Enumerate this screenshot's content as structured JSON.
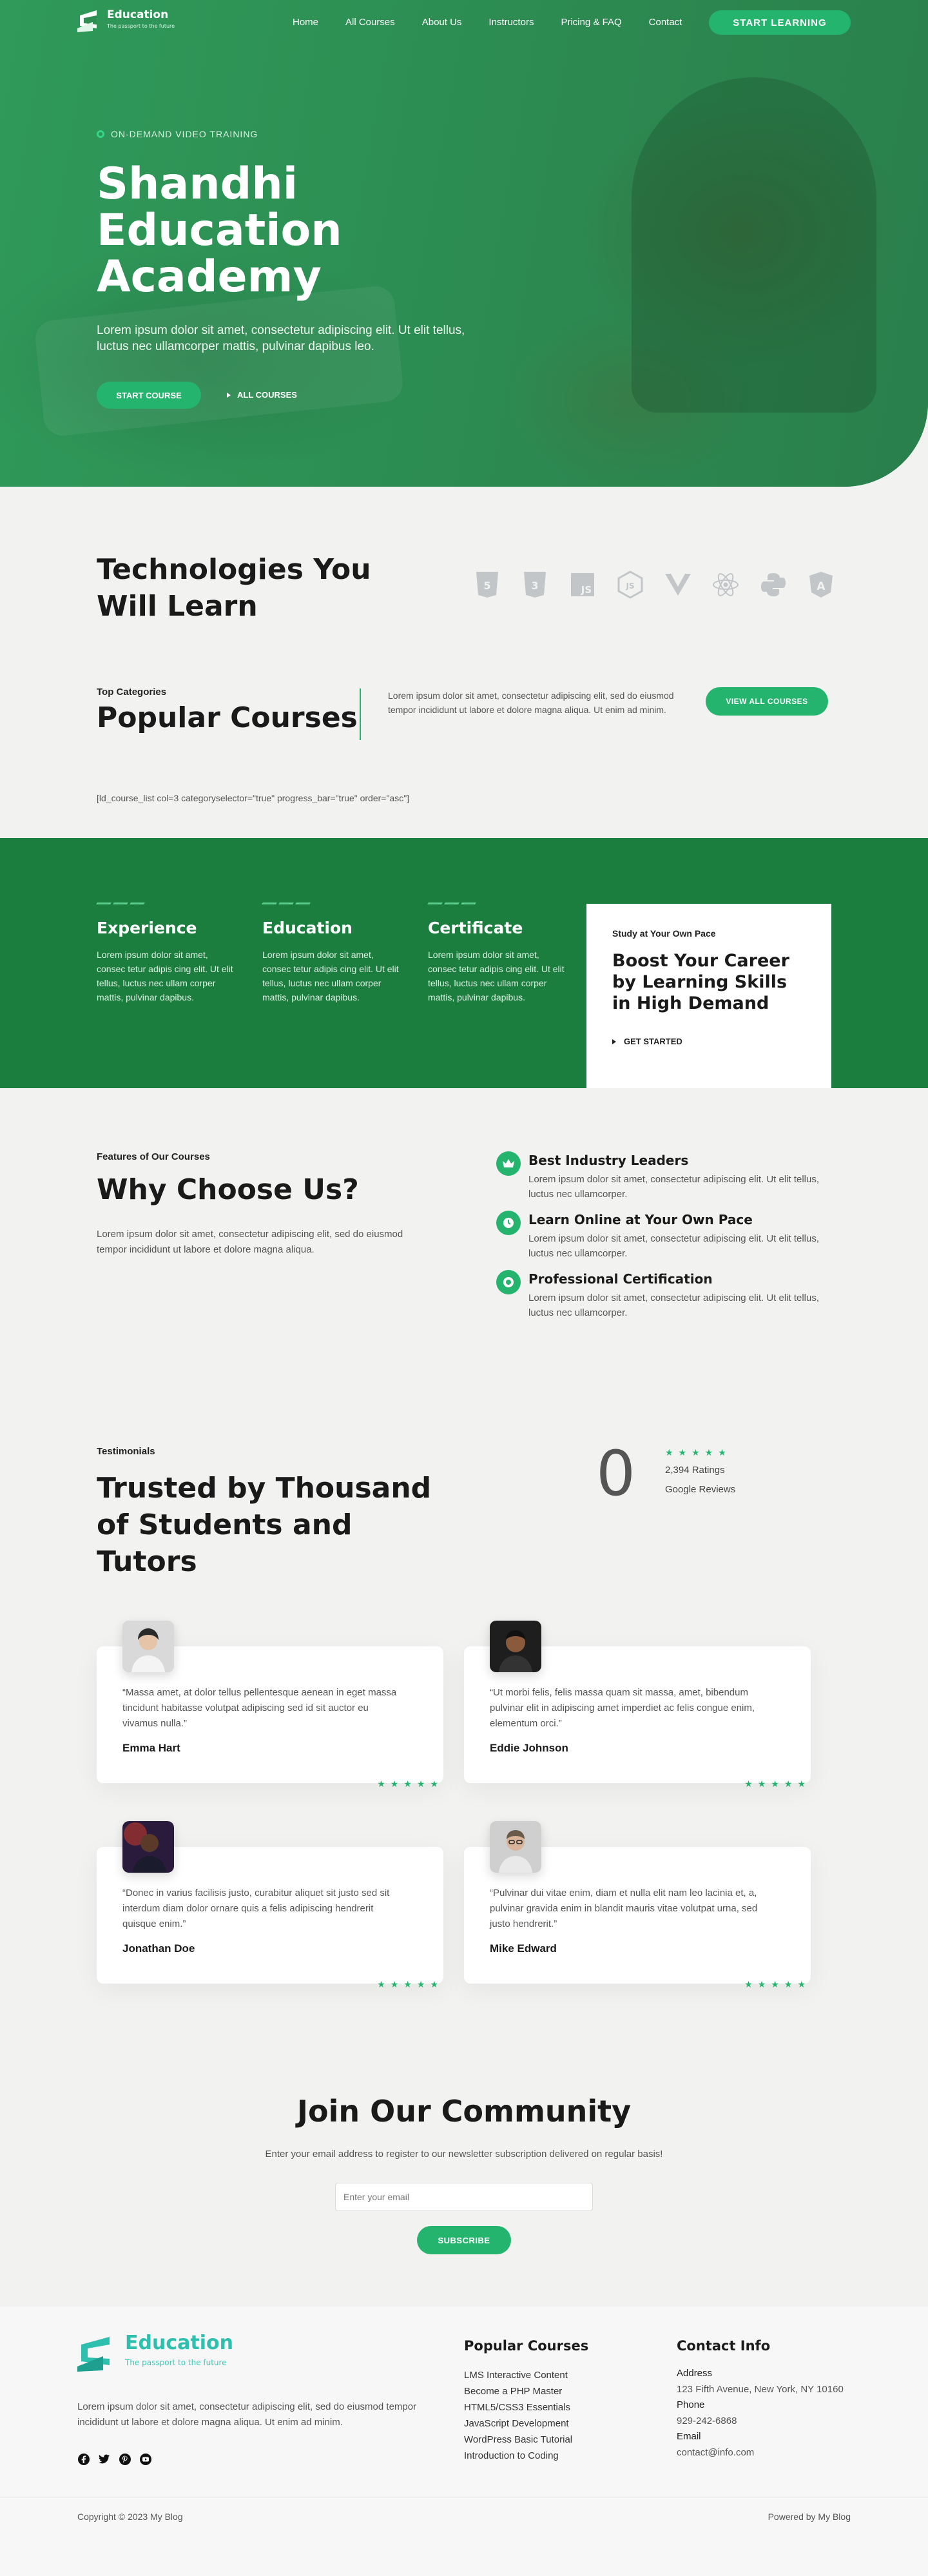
{
  "brand": {
    "name": "Education",
    "tagline": "The passport to the future",
    "colors": {
      "primary": "#25b46e",
      "dark_green": "#1c7e3e",
      "logo_teal": "#2fbfae"
    }
  },
  "nav": {
    "items": [
      "Home",
      "All Courses",
      "About Us",
      "Instructors",
      "Pricing & FAQ",
      "Contact"
    ],
    "cta": "START LEARNING"
  },
  "hero": {
    "eyebrow": "ON-DEMAND VIDEO TRAINING",
    "title": "Shandhi Education Academy",
    "description": "Lorem ipsum dolor sit amet, consectetur adipiscing elit. Ut elit tellus, luctus nec ullamcorper mattis, pulvinar dapibus leo.",
    "primary_button": "START COURSE",
    "secondary_link": "ALL COURSES"
  },
  "technologies": {
    "title": "Technologies You Will Learn",
    "icons": [
      "html5-icon",
      "css3-icon",
      "javascript-icon",
      "nodejs-icon",
      "vuejs-icon",
      "react-icon",
      "python-icon",
      "angular-icon"
    ]
  },
  "categories": {
    "label": "Top Categories",
    "title": "Popular Courses",
    "description": "Lorem ipsum dolor sit amet, consectetur adipiscing elit, sed do eiusmod tempor incididunt ut labore et dolore magna aliqua. Ut enim ad minim.",
    "button": "VIEW ALL COURSES",
    "shortcode": "[ld_course_list col=3 categoryselector=\"true\" progress_bar=\"true\" order=\"asc\"]"
  },
  "features": [
    {
      "title": "Experience",
      "text": "Lorem ipsum dolor sit amet, consec tetur adipis cing elit. Ut elit tellus, luctus nec ullam corper mattis, pulvinar dapibus."
    },
    {
      "title": "Education",
      "text": "Lorem ipsum dolor sit amet, consec tetur adipis cing elit. Ut elit tellus, luctus nec ullam corper mattis, pulvinar dapibus."
    },
    {
      "title": "Certificate",
      "text": "Lorem ipsum dolor sit amet, consec tetur adipis cing elit. Ut elit tellus, luctus nec ullam corper mattis, pulvinar dapibus."
    }
  ],
  "boost": {
    "eyebrow": "Study at Your Own Pace",
    "title": "Boost Your Career by Learning Skills in High Demand",
    "link": "GET STARTED"
  },
  "why": {
    "label": "Features of Our Courses",
    "title": "Why Choose Us?",
    "description": "Lorem ipsum dolor sit amet, consectetur adipiscing elit, sed do eiusmod tempor incididunt ut labore et dolore magna aliqua.",
    "items": [
      {
        "title": "Best Industry Leaders",
        "text": "Lorem ipsum dolor sit amet, consectetur adipiscing elit. Ut elit tellus, luctus nec ullamcorper.",
        "icon": "crown-icon"
      },
      {
        "title": "Learn Online at Your Own Pace",
        "text": "Lorem ipsum dolor sit amet, consectetur adipiscing elit. Ut elit tellus, luctus nec ullamcorper.",
        "icon": "clock-icon"
      },
      {
        "title": "Professional Certification",
        "text": "Lorem ipsum dolor sit amet, consectetur adipiscing elit. Ut elit tellus, luctus nec ullamcorper.",
        "icon": "certificate-icon"
      }
    ]
  },
  "testimonials": {
    "label": "Testimonials",
    "title": "Trusted by Thousand of Students and Tutors",
    "counter": "0",
    "stars": "★★★★★",
    "ratings": "2,394 Ratings",
    "source": "Google Reviews",
    "items": [
      {
        "quote": "“Massa amet, at dolor tellus pellentesque aenean in eget massa tincidunt habitasse volutpat adipiscing sed id sit auctor eu vivamus nulla.”",
        "name": "Emma Hart",
        "stars": "★★★★★"
      },
      {
        "quote": "“Ut morbi felis, felis massa quam sit massa, amet, bibendum pulvinar elit in adipiscing amet imperdiet ac felis congue enim, elementum orci.”",
        "name": "Eddie Johnson",
        "stars": "★★★★★"
      },
      {
        "quote": "“Donec in varius facilisis justo, curabitur aliquet sit justo sed sit interdum diam dolor ornare quis a felis adipiscing hendrerit quisque enim.”",
        "name": "Jonathan Doe",
        "stars": "★★★★★"
      },
      {
        "quote": "“Pulvinar dui vitae enim, diam et nulla elit nam leo lacinia et, a, pulvinar gravida enim in blandit mauris vitae volutpat urna, sed justo hendrerit.”",
        "name": "Mike Edward",
        "stars": "★★★★★"
      }
    ]
  },
  "community": {
    "title": "Join Our Community",
    "description": "Enter your email address to register to our newsletter subscription delivered on regular basis!",
    "placeholder": "Enter your email",
    "button": "SUBSCRIBE"
  },
  "footer": {
    "description": "Lorem ipsum dolor sit amet, consectetur adipiscing elit, sed do eiusmod tempor incididunt ut labore et dolore magna aliqua. Ut enim ad minim.",
    "social": [
      "facebook-icon",
      "twitter-icon",
      "pinterest-icon",
      "youtube-icon"
    ],
    "courses_title": "Popular Courses",
    "courses": [
      "LMS Interactive Content",
      "Become a PHP Master",
      "HTML5/CSS3 Essentials",
      "JavaScript Development",
      "WordPress Basic Tutorial",
      "Introduction to Coding"
    ],
    "contact_title": "Contact Info",
    "address_label": "Address",
    "address": "123 Fifth Avenue, New York, NY 10160",
    "phone_label": "Phone",
    "phone": "929-242-6868",
    "email_label": "Email",
    "email": "contact@info.com",
    "copyright": "Copyright © 2023 My Blog",
    "powered": "Powered by My Blog"
  }
}
